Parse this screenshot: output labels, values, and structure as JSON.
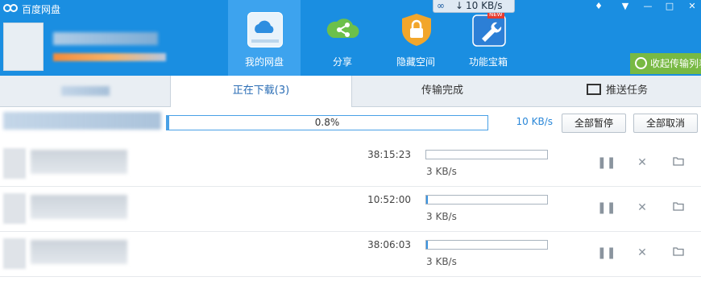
{
  "app": {
    "title": "百度网盘"
  },
  "header": {
    "speed_indicator": "10 KB/s",
    "nav": [
      {
        "label": "我的网盘",
        "icon": "cloud-icon",
        "active": true
      },
      {
        "label": "分享",
        "icon": "share-icon"
      },
      {
        "label": "隐藏空间",
        "icon": "lock-icon"
      },
      {
        "label": "功能宝箱",
        "icon": "wrench-icon",
        "badge": "NEW"
      }
    ],
    "collapse_label": "收起传输列表"
  },
  "tabs": [
    {
      "label": "正在下载(3)",
      "active": true
    },
    {
      "label": "传输完成"
    },
    {
      "label": "推送任务",
      "icon": "screen-icon"
    }
  ],
  "summary": {
    "progress_text": "0.8%",
    "progress_value": 0.008,
    "speed": "10 KB/s",
    "pause_all": "全部暂停",
    "cancel_all": "全部取消"
  },
  "downloads": [
    {
      "eta": "38:15:23",
      "speed": "3 KB/s",
      "progress": 0.0
    },
    {
      "eta": "10:52:00",
      "speed": "3 KB/s",
      "progress": 0.01
    },
    {
      "eta": "38:06:03",
      "speed": "3 KB/s",
      "progress": 0.01
    }
  ],
  "colors": {
    "header_bg": "#1a8ee1",
    "accent": "#2a87d8",
    "collapse_green": "#78b943"
  }
}
